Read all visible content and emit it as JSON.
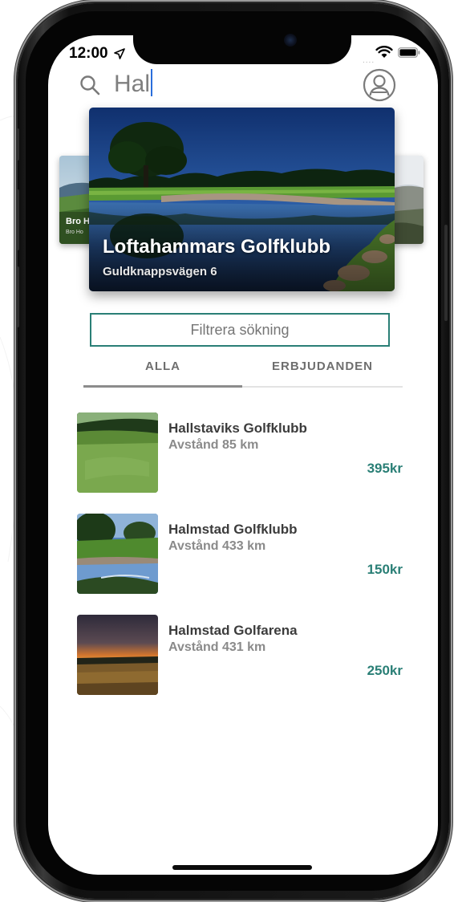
{
  "status_bar": {
    "time": "12:00",
    "signal": "....",
    "icons": [
      "location-arrow-icon",
      "wifi-icon",
      "battery-icon"
    ]
  },
  "search": {
    "value": "Hal",
    "icon": "search-icon",
    "profile_icon": "profile-icon"
  },
  "carousel": {
    "featured": {
      "title": "Loftahammars Golfklubb",
      "address": "Guldknappsvägen 6"
    },
    "previous": {
      "title": "Bro H",
      "address": "Bro Ho"
    }
  },
  "filter": {
    "placeholder": "Filtrera sökning"
  },
  "tabs": [
    {
      "label": "ALLA",
      "active": true
    },
    {
      "label": "ERBJUDANDEN",
      "active": false
    }
  ],
  "results": [
    {
      "name": "Hallstaviks Golfklubb",
      "distance": "Avstånd 85 km",
      "price": "395kr"
    },
    {
      "name": "Halmstad Golfklubb",
      "distance": "Avstånd 433 km",
      "price": "150kr"
    },
    {
      "name": "Halmstad Golfarena",
      "distance": "Avstånd 431 km",
      "price": "250kr"
    }
  ],
  "colors": {
    "accent": "#2a7f76",
    "tab_indicator": "#8c8c8c",
    "caret": "#2a6edb"
  }
}
